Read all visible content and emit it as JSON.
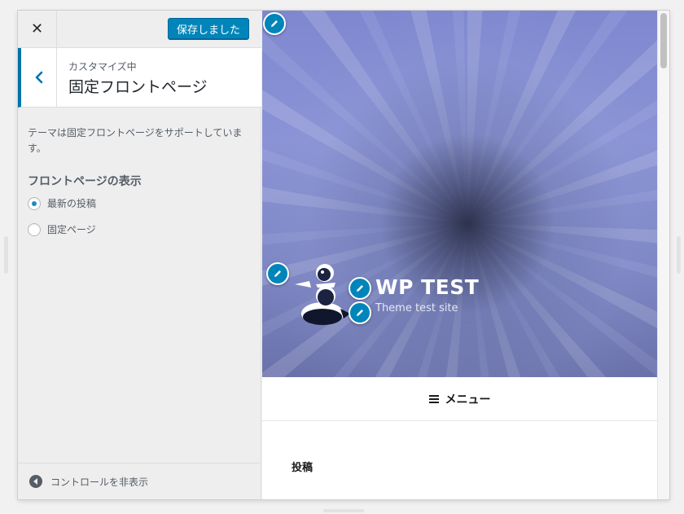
{
  "header": {
    "close_label": "✕",
    "save_label": "保存しました"
  },
  "section": {
    "crumb": "カスタマイズ中",
    "title": "固定フロントページ"
  },
  "panel": {
    "description": "テーマは固定フロントページをサポートしています。",
    "group_label": "フロントページの表示",
    "options": [
      {
        "label": "最新の投稿",
        "selected": true
      },
      {
        "label": "固定ページ",
        "selected": false
      }
    ]
  },
  "footer": {
    "collapse_label": "コントロールを非表示"
  },
  "preview": {
    "site_title": "WP TEST",
    "site_tagline": "Theme test site",
    "menu_label": "メニュー",
    "posts_heading": "投稿"
  },
  "colors": {
    "accent": "#0085ba",
    "sidebar_bg": "#eeeeee",
    "hero_tint": "#7f88cf"
  }
}
